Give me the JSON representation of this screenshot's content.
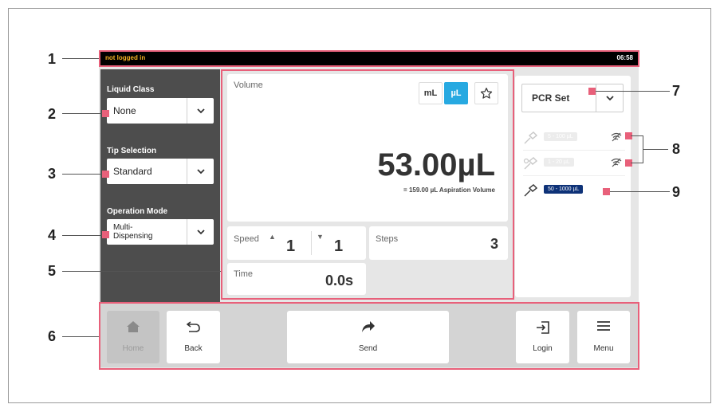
{
  "status_bar": {
    "login_state": "not logged in",
    "time": "06:58"
  },
  "left_panel": {
    "liquid_class": {
      "label": "Liquid Class",
      "value": "None"
    },
    "tip_selection": {
      "label": "Tip Selection",
      "value": "Standard"
    },
    "operation_mode": {
      "label": "Operation Mode",
      "value": "Multi-\nDispensing"
    }
  },
  "volume": {
    "label": "Volume",
    "unit_ml": "mL",
    "unit_ul": "µL",
    "selected_unit": "µL",
    "value": "53.00µL",
    "aspiration": "= 159.00 µL Aspiration Volume"
  },
  "speed": {
    "label": "Speed",
    "up_value": "1",
    "down_value": "1"
  },
  "steps": {
    "label": "Steps",
    "value": "3"
  },
  "time": {
    "label": "Time",
    "value": "0.0s"
  },
  "right_panel": {
    "pcr_set": "PCR Set",
    "tips": [
      {
        "range": "5 - 100 µL",
        "active": false
      },
      {
        "range": "1 - 20 µL",
        "active": false
      },
      {
        "range": "50 - 1000 µL",
        "active": true
      }
    ]
  },
  "bottom_nav": {
    "home": "Home",
    "back": "Back",
    "send": "Send",
    "login": "Login",
    "menu": "Menu"
  },
  "callouts": [
    "1",
    "2",
    "3",
    "4",
    "5",
    "6",
    "7",
    "8",
    "9"
  ],
  "colors": {
    "accent_blue": "#27a9e1",
    "tip_active": "#0e3278",
    "callout": "#e8607a",
    "status_text": "#f4b223"
  }
}
